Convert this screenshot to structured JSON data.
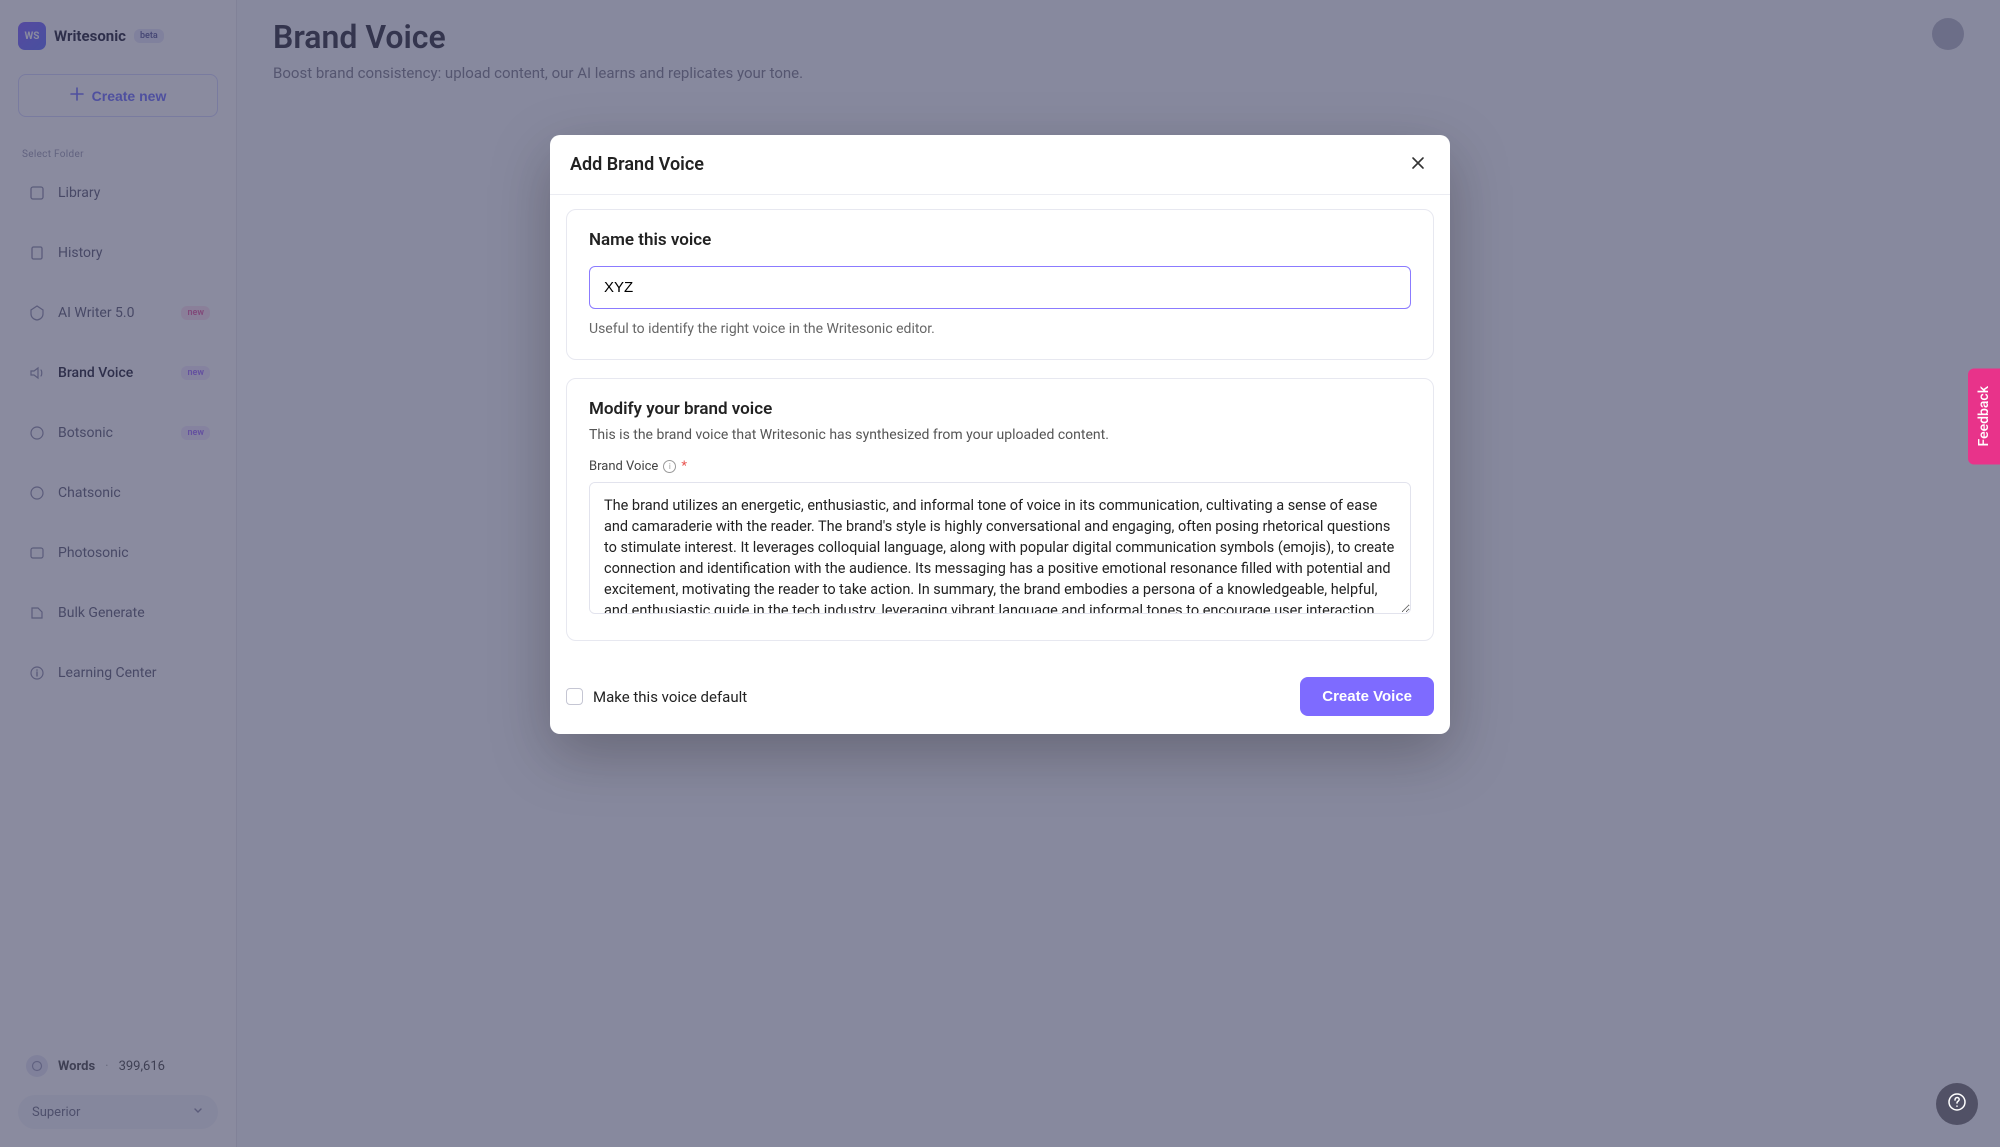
{
  "brand": {
    "logo_initials": "WS",
    "logo_text": "Writesonic",
    "logo_badge": "beta"
  },
  "sidebar": {
    "create_label": "Create new",
    "section_label": "Select Folder",
    "items": [
      {
        "label": "Library"
      },
      {
        "label": "History"
      },
      {
        "label": "AI Writer 5.0",
        "badge": "new",
        "badge_class": "pink"
      },
      {
        "label": "Brand Voice",
        "badge": "new"
      },
      {
        "label": "Botsonic",
        "badge": "new"
      },
      {
        "label": "Chatsonic"
      },
      {
        "label": "Photosonic"
      },
      {
        "label": "Bulk Generate"
      },
      {
        "label": "Learning Center"
      }
    ],
    "words_label": "Words",
    "words_count": "399,616",
    "plan_label": "Superior"
  },
  "page": {
    "title": "Brand Voice",
    "subtitle": "Boost brand consistency: upload content, our AI learns and replicates your tone."
  },
  "modal": {
    "title": "Add Brand Voice",
    "card1_title": "Name this voice",
    "name_value": "XYZ",
    "name_helper": "Useful to identify the right voice in the Writesonic editor.",
    "card2_title": "Modify your brand voice",
    "card2_desc": "This is the brand voice that Writesonic has synthesized from your uploaded content.",
    "field_label": "Brand Voice",
    "textarea_value": "The brand utilizes an energetic, enthusiastic, and informal tone of voice in its communication, cultivating a sense of ease and camaraderie with the reader. The brand's style is highly conversational and engaging, often posing rhetorical questions to stimulate interest. It leverages colloquial language, along with popular digital communication symbols (emojis), to create connection and identification with the audience. Its messaging has a positive emotional resonance filled with potential and excitement, motivating the reader to take action. In summary, the brand embodies a persona of a knowledgeable, helpful, and enthusiastic guide in the tech industry, leveraging vibrant language and informal tones to encourage user interaction and engagement.",
    "default_label": "Make this voice default",
    "create_label": "Create Voice"
  },
  "feedback_label": "Feedback",
  "colors": {
    "accent": "#7e6bff",
    "feedback": "#e8338a"
  }
}
